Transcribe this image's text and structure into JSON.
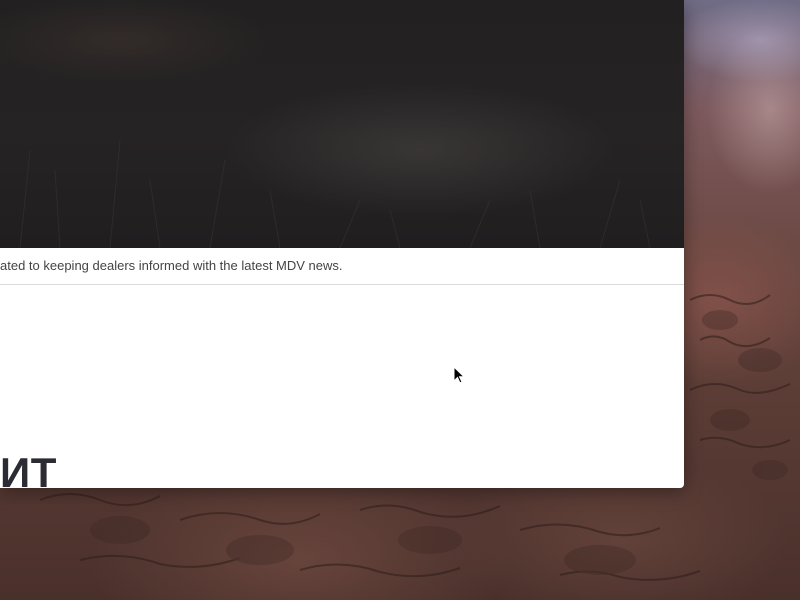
{
  "page": {
    "tagline": "ated to keeping dealers informed with the latest MDV news.",
    "headline_fragment": "ИТ"
  },
  "icons": {
    "cursor": "mouse-pointer-icon"
  },
  "colors": {
    "hero_background": "#232122",
    "window_background": "#ffffff",
    "headline_text": "#2b2b33",
    "tagline_text": "#444444",
    "divider": "#d9d9d9"
  }
}
